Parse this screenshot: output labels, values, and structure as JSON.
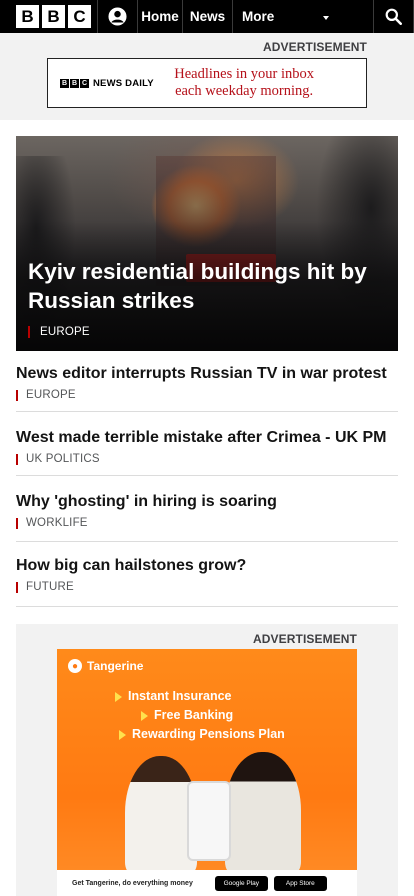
{
  "nav": {
    "logo_letters": [
      "B",
      "B",
      "C"
    ],
    "items": [
      "Home",
      "News",
      "More"
    ]
  },
  "ad_top": {
    "label": "ADVERTISEMENT",
    "brand": "NEWS DAILY",
    "brand_letters": [
      "B",
      "B",
      "C"
    ],
    "copy_line1": "Headlines in your inbox",
    "copy_line2": "each weekday morning."
  },
  "hero": {
    "title": "Kyiv residential buildings hit by Russian strikes",
    "tag": "EUROPE"
  },
  "stories": [
    {
      "title": "News editor interrupts Russian TV in war protest",
      "tag": "EUROPE"
    },
    {
      "title": "West made terrible mistake after Crimea - UK PM",
      "tag": "UK POLITICS"
    },
    {
      "title": "Why 'ghosting' in hiring is soaring",
      "tag": "WORKLIFE"
    },
    {
      "title": "How big can hailstones grow?",
      "tag": "FUTURE"
    }
  ],
  "ad_bottom": {
    "label": "ADVERTISEMENT",
    "brand": "Tangerine",
    "lines": [
      "Instant Insurance",
      "Free Banking",
      "Rewarding Pensions Plan"
    ],
    "footer": "Get Tangerine, do everything money",
    "store_google": "Google Play",
    "store_apple": "App Store"
  },
  "colors": {
    "brand_black": "#000000",
    "accent_red": "#b80000",
    "ad_red": "#b5111a",
    "tangerine_orange": "#ff7a12"
  }
}
